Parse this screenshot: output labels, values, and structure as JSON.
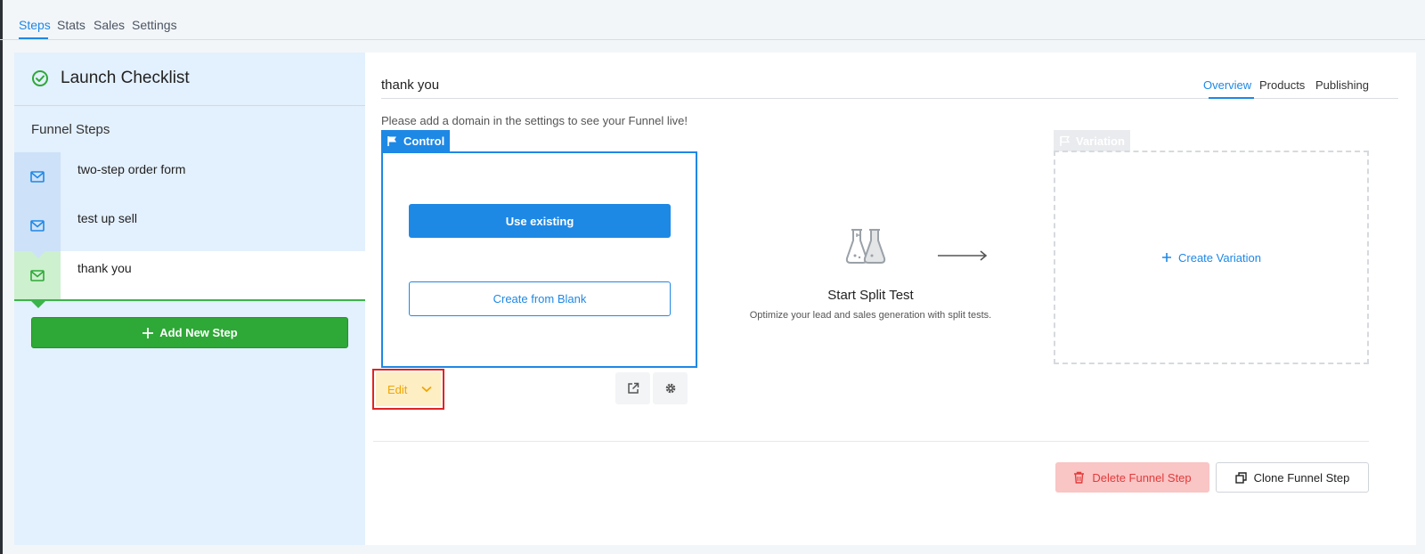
{
  "top_tabs": [
    "Steps",
    "Stats",
    "Sales",
    "Settings"
  ],
  "sidebar": {
    "launch_title": "Launch Checklist",
    "section_title": "Funnel Steps",
    "steps": [
      {
        "label": "two-step order form",
        "icon": "mail-icon"
      },
      {
        "label": "test up sell",
        "icon": "mail-icon"
      },
      {
        "label": "thank you",
        "icon": "mail-icon",
        "active": true
      }
    ],
    "add_step_label": "Add New Step"
  },
  "main": {
    "step_title": "thank you",
    "subtabs": [
      "Overview",
      "Products",
      "Publishing"
    ],
    "notice": "Please add a domain in the settings to see your Funnel live!",
    "control": {
      "tag": "Control",
      "use_existing": "Use existing",
      "create_blank": "Create from Blank",
      "edit_label": "Edit"
    },
    "split_test": {
      "title": "Start Split Test",
      "description": "Optimize your lead and sales generation with split tests."
    },
    "variation": {
      "tag": "Variation",
      "create_label": "Create Variation"
    },
    "delete_label": "Delete Funnel Step",
    "clone_label": "Clone Funnel Step"
  },
  "colors": {
    "accent": "#1e88e5",
    "success": "#2ea836",
    "danger": "#e33b3b",
    "warning": "#f0a500"
  }
}
